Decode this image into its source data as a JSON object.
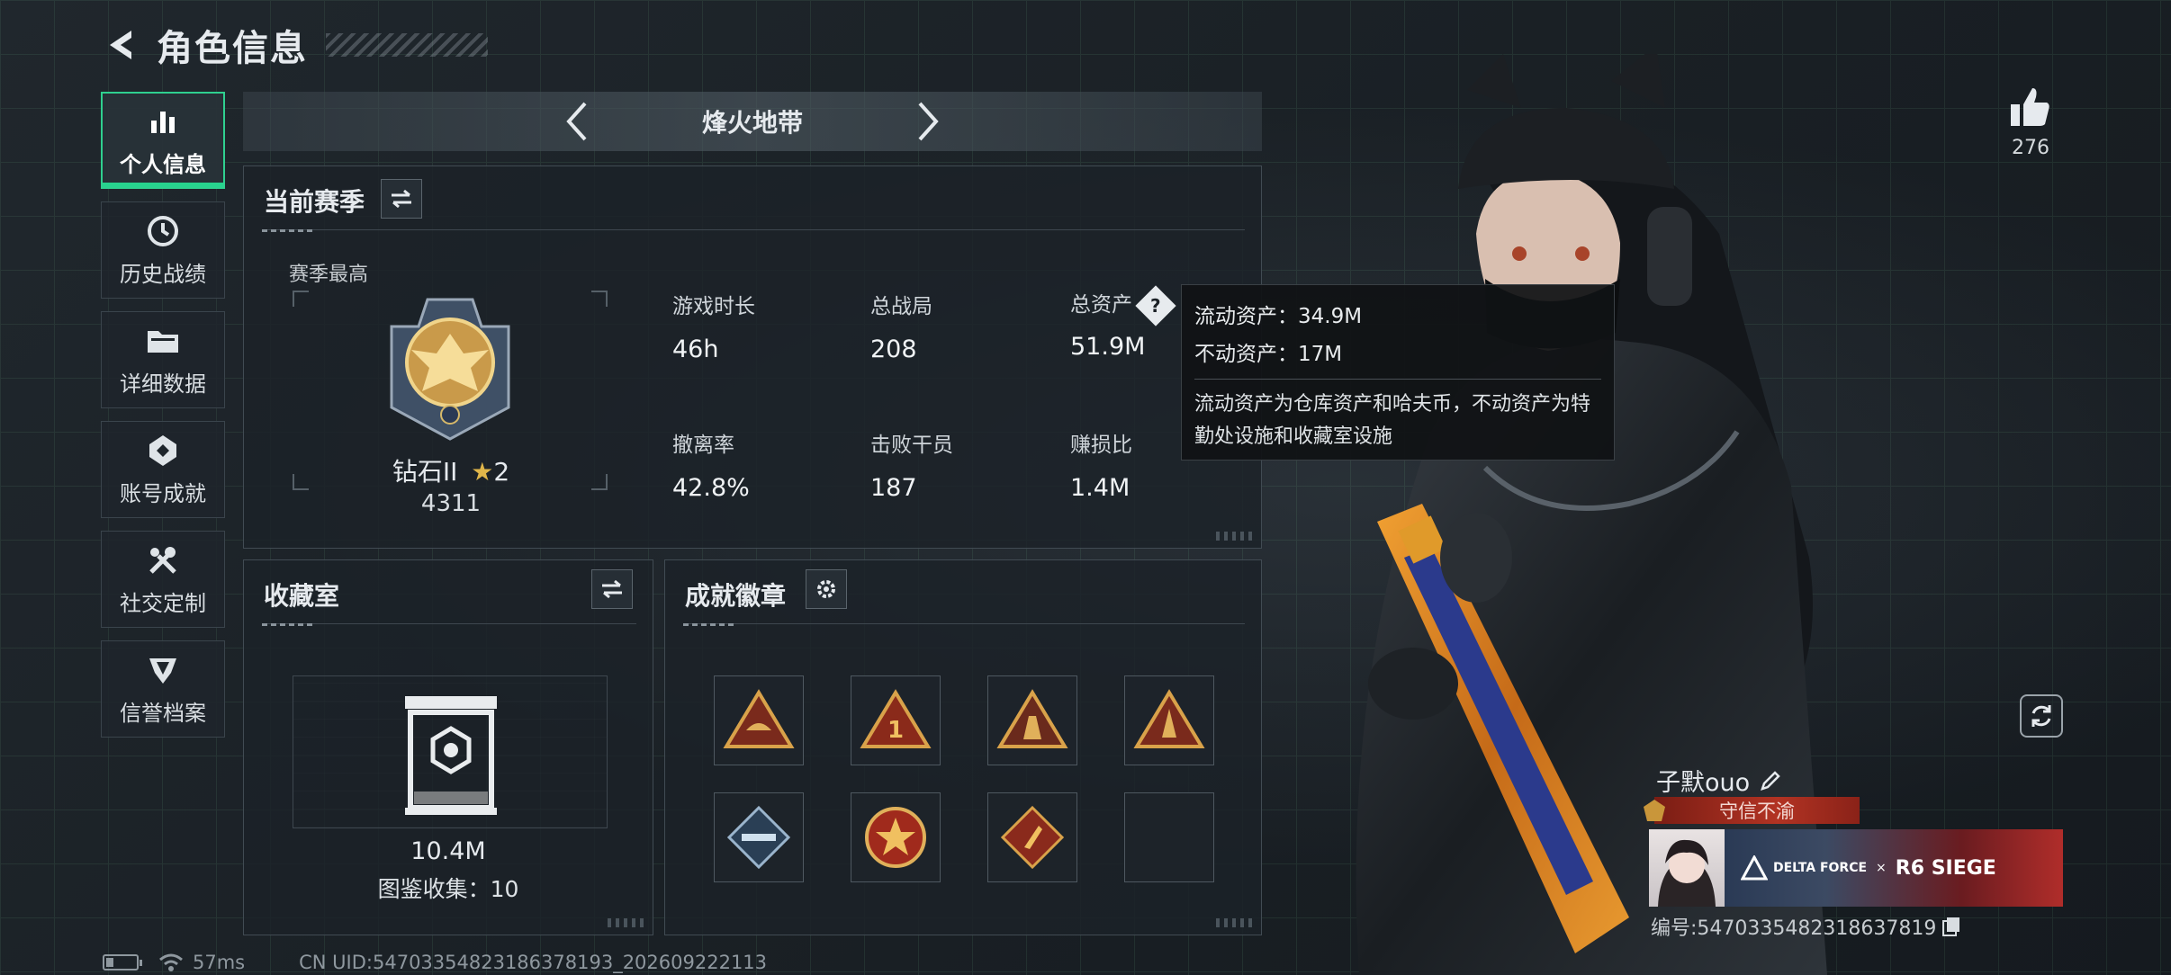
{
  "header": {
    "title": "角色信息"
  },
  "nav": {
    "items": [
      {
        "label": "个人信息",
        "icon": "bar-chart-icon",
        "active": true
      },
      {
        "label": "历史战绩",
        "icon": "history-clock-icon"
      },
      {
        "label": "详细数据",
        "icon": "folder-icon"
      },
      {
        "label": "账号成就",
        "icon": "achievement-icon"
      },
      {
        "label": "社交定制",
        "icon": "tools-icon"
      },
      {
        "label": "信誉档案",
        "icon": "reputation-icon"
      }
    ]
  },
  "mode": {
    "name": "烽火地带"
  },
  "season": {
    "title": "当前赛季",
    "best_label": "赛季最高",
    "rank_name": "钻石II",
    "rank_stars": "2",
    "rank_score": "4311",
    "stats": [
      {
        "label": "游戏时长",
        "value": "46h"
      },
      {
        "label": "总战局",
        "value": "208"
      },
      {
        "label": "总资产",
        "value": "51.9M"
      },
      {
        "label": "撤离率",
        "value": "42.8%"
      },
      {
        "label": "击败干员",
        "value": "187"
      },
      {
        "label": "赚损比",
        "value": "1.4M"
      }
    ]
  },
  "tooltip": {
    "liquid": "流动资产：34.9M",
    "fixed": "不动资产：17M",
    "desc": "流动资产为仓库资产和哈夫币，不动资产为特勤处设施和收藏室设施"
  },
  "collection": {
    "title": "收藏室",
    "value": "10.4M",
    "count": "图鉴收集：10"
  },
  "badges": {
    "title": "成就徽章"
  },
  "profile": {
    "likes": "276",
    "name": "子默ouo",
    "title_tag": "守信不渝",
    "banner_brand": "DELTA FORCE",
    "banner_x": "×",
    "banner_collab": "R6 SIEGE",
    "uid": "编号:5470335482318637819"
  },
  "status": {
    "ping": "57ms",
    "uid_line": "CN UID:54703354823186378193_202609222113"
  },
  "colors": {
    "accent": "#27d38e",
    "tag_red": "#b23323"
  }
}
